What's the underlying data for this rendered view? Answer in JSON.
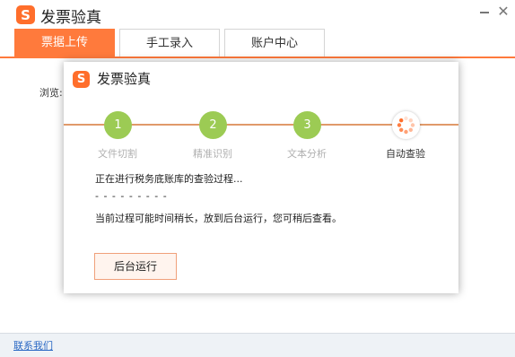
{
  "app": {
    "title": "发票验真",
    "logo_letter": "S"
  },
  "tabs": [
    {
      "label": "票据上传"
    },
    {
      "label": "手工录入"
    },
    {
      "label": "账户中心"
    }
  ],
  "main": {
    "browse_label": "浏览:"
  },
  "footer": {
    "contact_link": "联系我们"
  },
  "dialog": {
    "title": "发票验真",
    "logo_letter": "S",
    "steps": [
      {
        "number": "1",
        "label": "文件切割"
      },
      {
        "number": "2",
        "label": "精准识别"
      },
      {
        "number": "3",
        "label": "文本分析"
      },
      {
        "label": "自动查验",
        "icon": "loading-spinner-icon"
      }
    ],
    "status": "正在进行税务底账库的查验过程...",
    "dashes": "- - - - - - - - -",
    "hint": "当前过程可能时间稍长，放到后台运行，您可稍后查看。",
    "background_button": "后台运行"
  },
  "colors": {
    "accent": "#ff7a3c",
    "step_done": "#9ccb54",
    "link": "#2a68c4"
  }
}
